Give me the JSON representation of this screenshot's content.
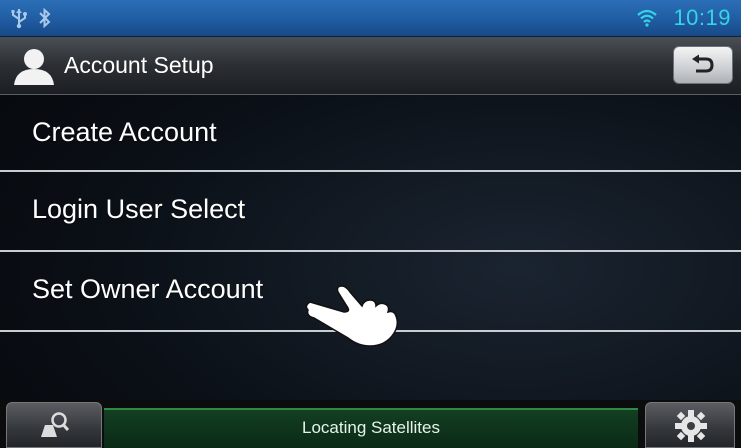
{
  "status_bar": {
    "left_icons": [
      "usb-icon",
      "bluetooth-icon"
    ],
    "wifi_icon": "wifi-icon",
    "time": "10:19",
    "bar_color": "#2165ac",
    "time_color": "#35d3e8"
  },
  "header": {
    "title": "Account Setup",
    "user_icon": "user-icon",
    "back_icon": "back-arrow-icon"
  },
  "menu": {
    "items": [
      {
        "label": "Create Account"
      },
      {
        "label": "Login User Select"
      },
      {
        "label": "Set Owner Account"
      }
    ]
  },
  "bottom_bar": {
    "left_button_icon": "map-search-icon",
    "status_text": "Locating Satellites",
    "status_color": "#0f3a1e",
    "right_button_icon": "gear-icon"
  },
  "overlay": {
    "pointer_icon": "hand-pointer-icon"
  }
}
